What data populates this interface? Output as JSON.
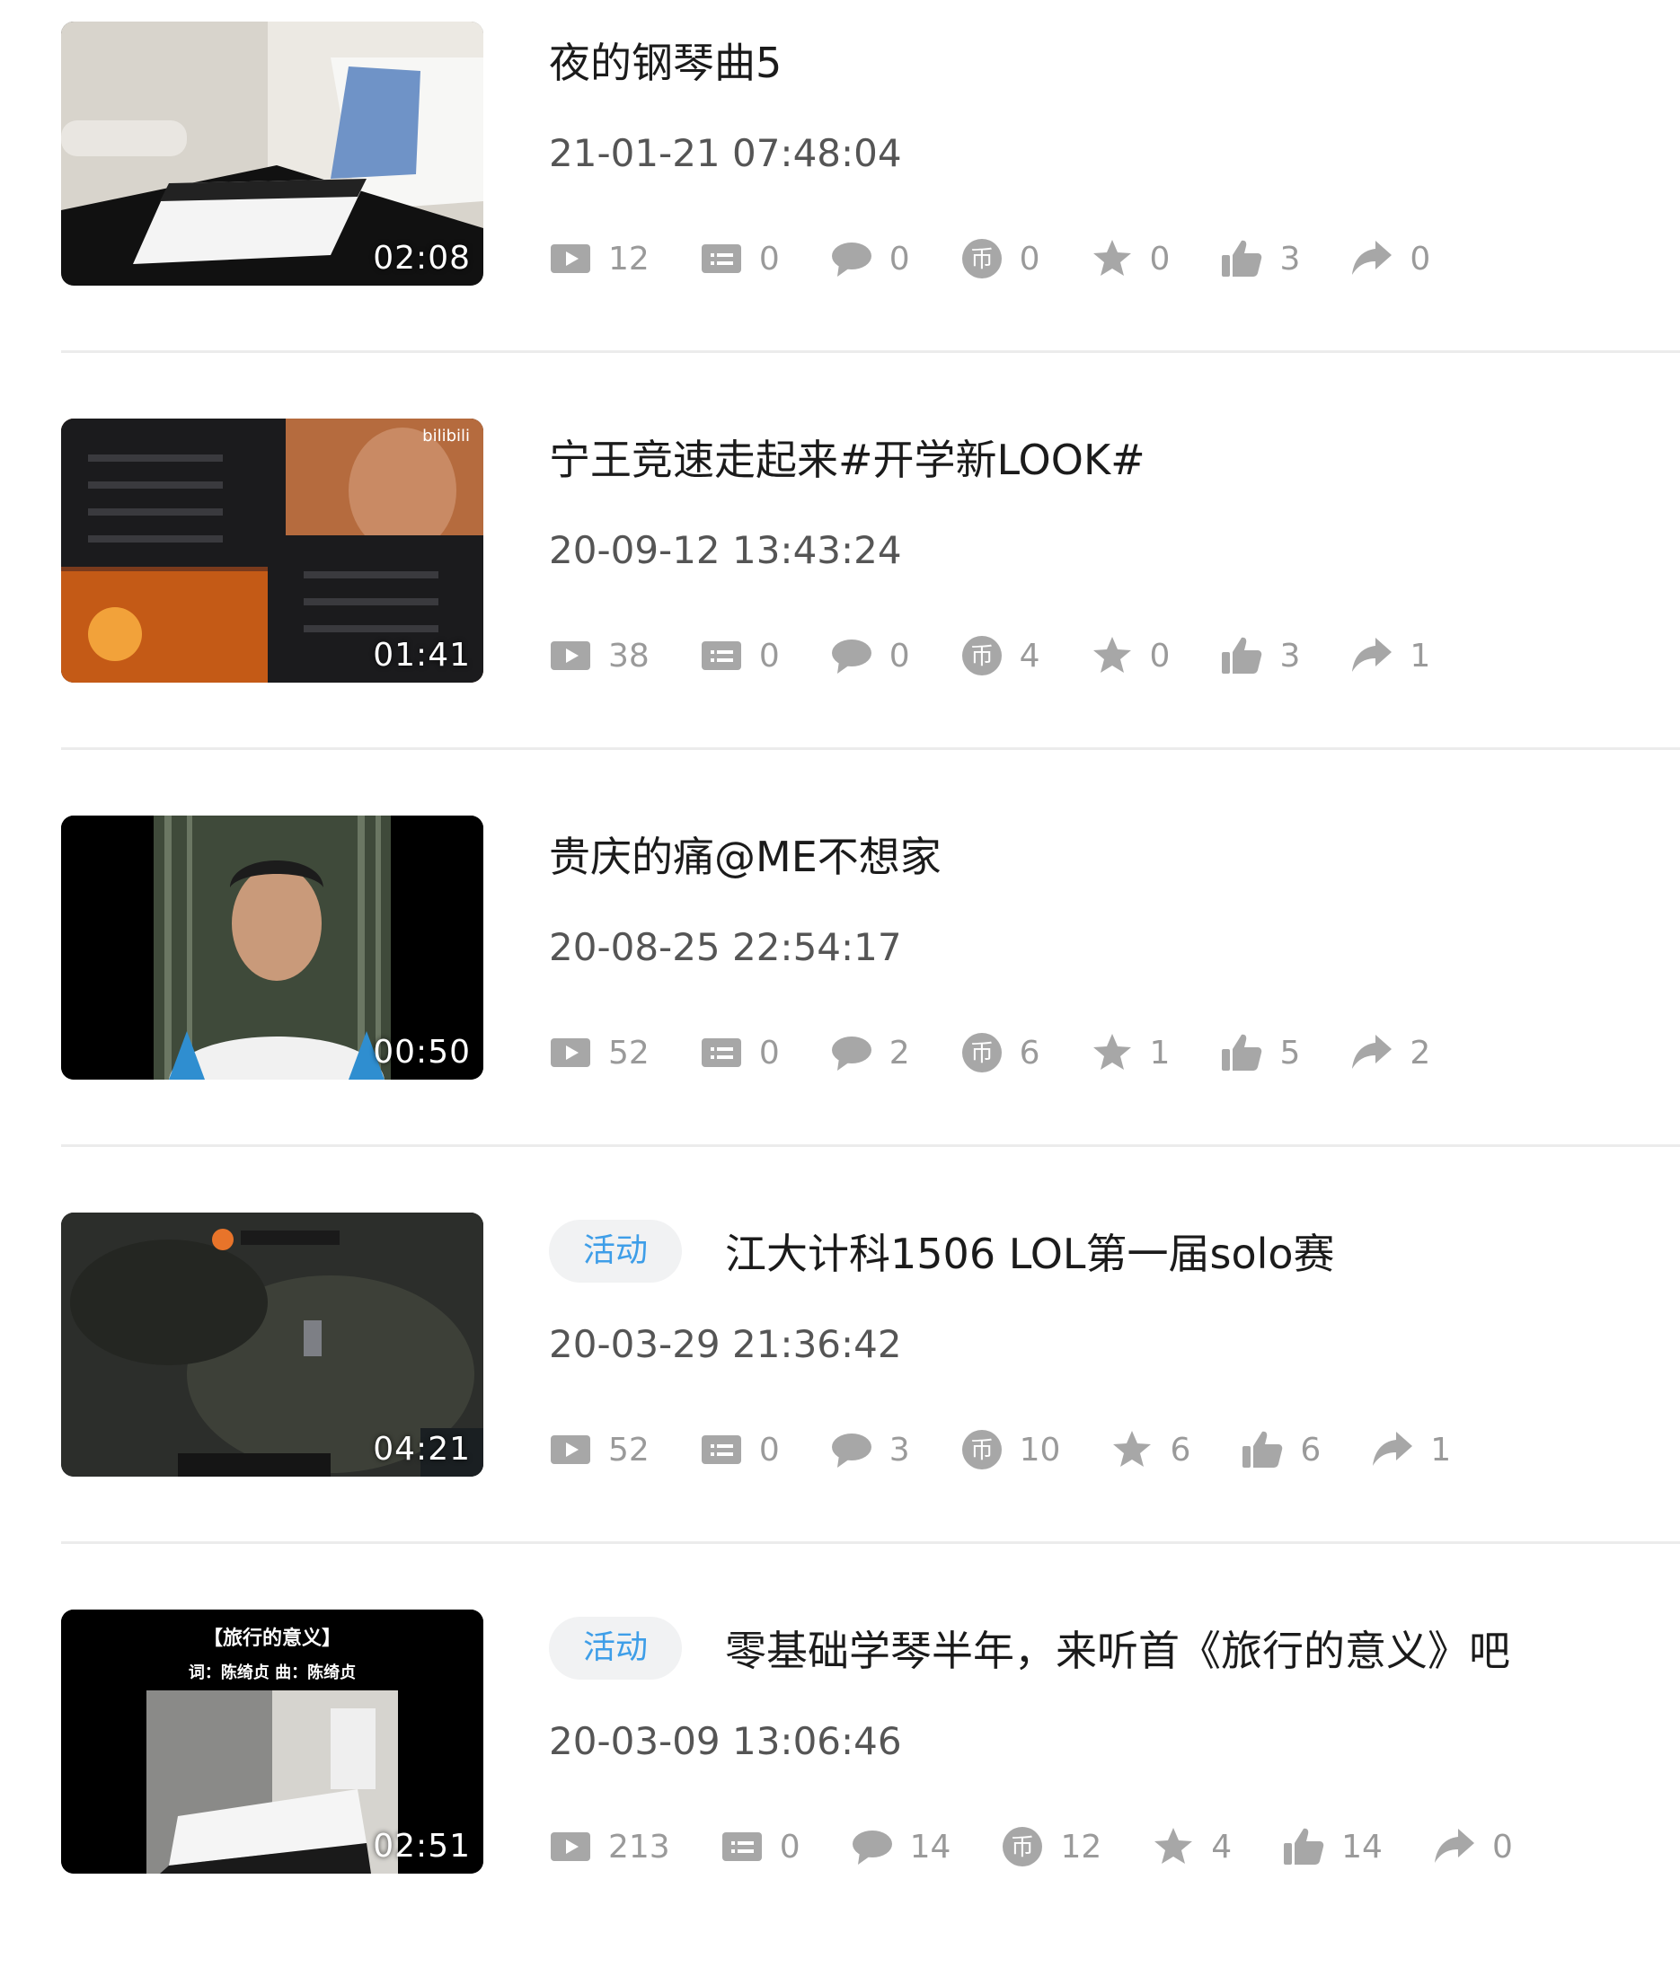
{
  "videos": [
    {
      "badge": "",
      "title": "夜的钢琴曲5",
      "date": "21-01-21 07:48:04",
      "duration": "02:08",
      "stats": {
        "plays": "12",
        "danmaku": "0",
        "comments": "0",
        "coins": "0",
        "favorites": "0",
        "likes": "3",
        "shares": "0"
      }
    },
    {
      "badge": "",
      "title": "宁王竞速走起来#开学新LOOK#",
      "date": "20-09-12 13:43:24",
      "duration": "01:41",
      "stats": {
        "plays": "38",
        "danmaku": "0",
        "comments": "0",
        "coins": "4",
        "favorites": "0",
        "likes": "3",
        "shares": "1"
      }
    },
    {
      "badge": "",
      "title": "贵庆的痛@ME不想家",
      "date": "20-08-25 22:54:17",
      "duration": "00:50",
      "stats": {
        "plays": "52",
        "danmaku": "0",
        "comments": "2",
        "coins": "6",
        "favorites": "1",
        "likes": "5",
        "shares": "2"
      }
    },
    {
      "badge": "活动",
      "title": "江大计科1506 LOL第一届solo赛",
      "date": "20-03-29 21:36:42",
      "duration": "04:21",
      "stats": {
        "plays": "52",
        "danmaku": "0",
        "comments": "3",
        "coins": "10",
        "favorites": "6",
        "likes": "6",
        "shares": "1"
      }
    },
    {
      "badge": "活动",
      "title": "零基础学琴半年，来听首《旅行的意义》吧",
      "date": "20-03-09 13:06:46",
      "duration": "02:51",
      "thumb_text": {
        "line1": "【旅行的意义】",
        "line2": "词：陈绮贞   曲：陈绮贞"
      },
      "stats": {
        "plays": "213",
        "danmaku": "0",
        "comments": "14",
        "coins": "12",
        "favorites": "4",
        "likes": "14",
        "shares": "0"
      }
    }
  ],
  "icons": [
    "play-count-icon",
    "danmaku-icon",
    "comment-icon",
    "coin-icon",
    "favorite-icon",
    "like-icon",
    "share-icon"
  ],
  "colors": {
    "badge_text": "#3e9ee8",
    "badge_bg": "#f1f2f3",
    "stat_icon": "#a7a7a7",
    "stat_text": "#9a9a9a"
  }
}
